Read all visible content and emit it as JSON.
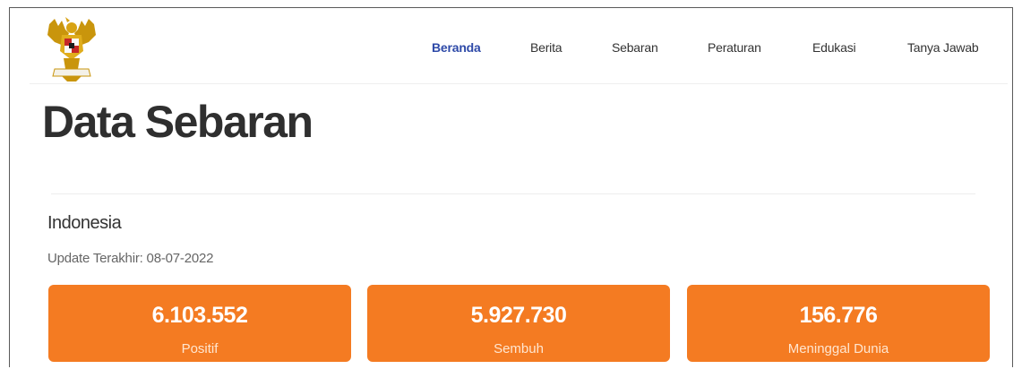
{
  "header": {
    "logo_icon": "garuda-emblem-icon",
    "nav": [
      {
        "label": "Beranda",
        "active": true
      },
      {
        "label": "Berita",
        "active": false
      },
      {
        "label": "Sebaran",
        "active": false
      },
      {
        "label": "Peraturan",
        "active": false
      },
      {
        "label": "Edukasi",
        "active": false
      },
      {
        "label": "Tanya Jawab",
        "active": false
      }
    ]
  },
  "main": {
    "title": "Data Sebaran",
    "country": "Indonesia",
    "update_text": "Update Terakhir: 08-07-2022",
    "stats": [
      {
        "value": "6.103.552",
        "label": "Positif"
      },
      {
        "value": "5.927.730",
        "label": "Sembuh"
      },
      {
        "value": "156.776",
        "label": "Meninggal Dunia"
      }
    ]
  },
  "colors": {
    "nav_active": "#2e4aa8",
    "card_orange": "#f47b22",
    "title_text": "#2f2f2f"
  }
}
